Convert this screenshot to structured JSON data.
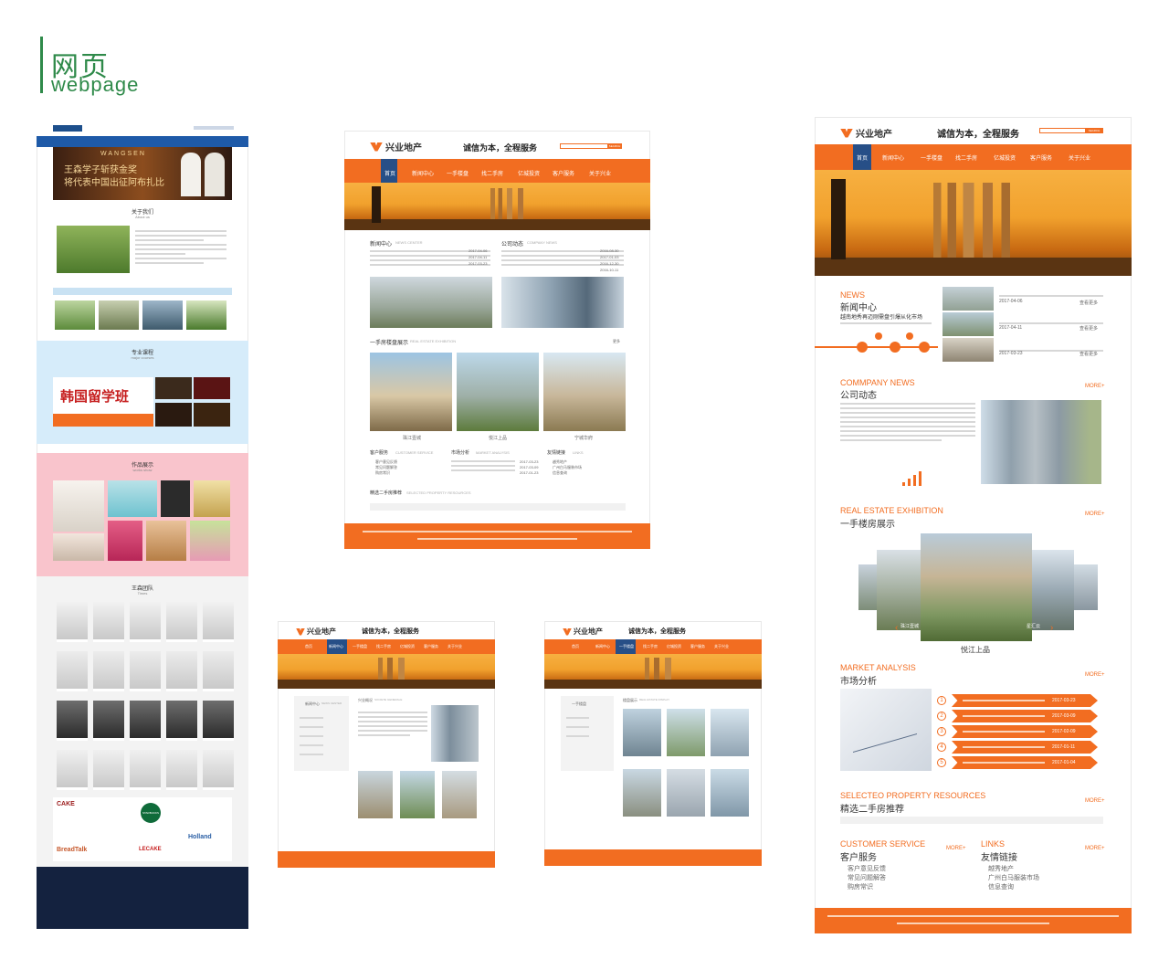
{
  "tag": {
    "cn": "网页",
    "en": "webpage"
  },
  "site1": {
    "brand": "兴业地产",
    "slogan": "诚信为本，全程服务",
    "search_btn": "SEARCH",
    "nav": [
      "首页",
      "新闻中心",
      "一手楼盘",
      "找二手房",
      "亿城投资",
      "客户服务",
      "关于兴业"
    ],
    "news_title": "新闻中心",
    "news_en": "NEWS CENTER",
    "company_title": "公司动态",
    "company_en": "COMPANY NEWS",
    "news_items": [
      "2017-04-06",
      "2017-04-11",
      "2017-03-23"
    ],
    "company_items": [
      "2016-08-30",
      "2017-01-03",
      "2016-12-30",
      "2016-10-11"
    ],
    "exhibit_title": "一手房楼盘展示",
    "exhibit_en": "REAL ESTATE EXHIBITION",
    "more": "更多",
    "buildings": [
      "珠江壹城",
      "悦江上品",
      "宁城华府"
    ],
    "svc_title": "客户服务",
    "svc_en": "CUSTOMER SERVICE",
    "market_title": "市场分析",
    "market_en": "MARKET ANALYSIS",
    "links_title": "友情链接",
    "links_en": "LINKS",
    "svc_items": [
      "客户意见反馈",
      "常见问题解答",
      "购房常识"
    ],
    "market_dates": [
      "2017-03-23",
      "2017-03-09",
      "2017-01-23"
    ],
    "links_items": [
      "越秀地产",
      "广州白马服装市场",
      "信息查询"
    ],
    "select_title": "精选二手房推荐",
    "select_en": "SELECTED PROPERTY RESOURCES"
  },
  "site2": {
    "brand": "兴业地产",
    "slogan": "诚信为本，全程服务",
    "search_btn": "SEARCH",
    "nav": [
      "首页",
      "新闻中心",
      "一手楼盘",
      "找二手房",
      "亿城投资",
      "客户服务",
      "关于兴业"
    ],
    "news_en": "NEWS",
    "news_cn": "新闻中心",
    "news_headline": "越南地秀再迈刚需盘引爆从化市场",
    "news_dates": [
      "2017-04-06",
      "2017-04-11",
      "2017-03-23"
    ],
    "view_more": "查看更多",
    "company_en": "COMMPANY NEWS",
    "company_cn": "公司动态",
    "more": "MORE+",
    "exhibit_en": "REAL ESTATE EXHIBITION",
    "exhibit_cn": "一手楼房展示",
    "carousel_main": "悦江上品",
    "carousel_left": "珠江壹城",
    "carousel_right": "星汇云",
    "market_en": "MARKET ANALYSIS",
    "market_cn": "市场分析",
    "market_dates": [
      "2017-03-23",
      "2017-03-09",
      "2017-02-09",
      "2017-01-11",
      "2017-01-04"
    ],
    "market_nums": [
      "1",
      "2",
      "3",
      "4",
      "5"
    ],
    "select_en": "SELECTEO PROPERTY RESOURCES",
    "select_cn": "精选二手房推荐",
    "svc_en": "CUSTOMER SERVICE",
    "svc_cn": "客户服务",
    "svc_items": [
      "客户意见反馈",
      "常见问题解答",
      "购房常识"
    ],
    "links_en": "LINKS",
    "links_cn": "友情链接",
    "links_items": [
      "越秀地产",
      "广州白马服装市场",
      "信息查询"
    ]
  },
  "site3": {
    "brand": "兴业地产",
    "slogan": "诚信为本，全程服务",
    "nav": [
      "首页",
      "新闻中心",
      "一手楼盘",
      "找二手房",
      "亿城投资",
      "客户服务",
      "关于兴业"
    ],
    "side_title": "新闻中心",
    "side_en": "NEWS CENTER",
    "main_title": "兴业概况",
    "main_en": "SOCIETE GENERALE"
  },
  "site4": {
    "brand": "兴业地产",
    "slogan": "诚信为本，全程服务",
    "nav": [
      "首页",
      "新闻中心",
      "一手楼盘",
      "找二手房",
      "亿城投资",
      "客户服务",
      "关于兴业"
    ],
    "side_title": "一手楼盘",
    "main_title": "楼盘展示",
    "main_en": "REAL ESTATE DISPLAY"
  },
  "school": {
    "slogan_en": "WANGSEN",
    "banner_l1": "王森学子斩获金奖",
    "banner_l2": "将代表中国出征阿布扎比",
    "about_cn": "关于我们",
    "about_en": "About us",
    "courses_cn": "专业课程",
    "courses_en": "major courses",
    "korea": "韩国留学班",
    "works_cn": "作品展示",
    "works_en": "works show",
    "team_cn": "王森团队",
    "team_en": "Times",
    "brands": [
      "CAKE",
      "STARBUCKS",
      "Holland",
      "BreadTalk",
      "LECAKE"
    ]
  }
}
